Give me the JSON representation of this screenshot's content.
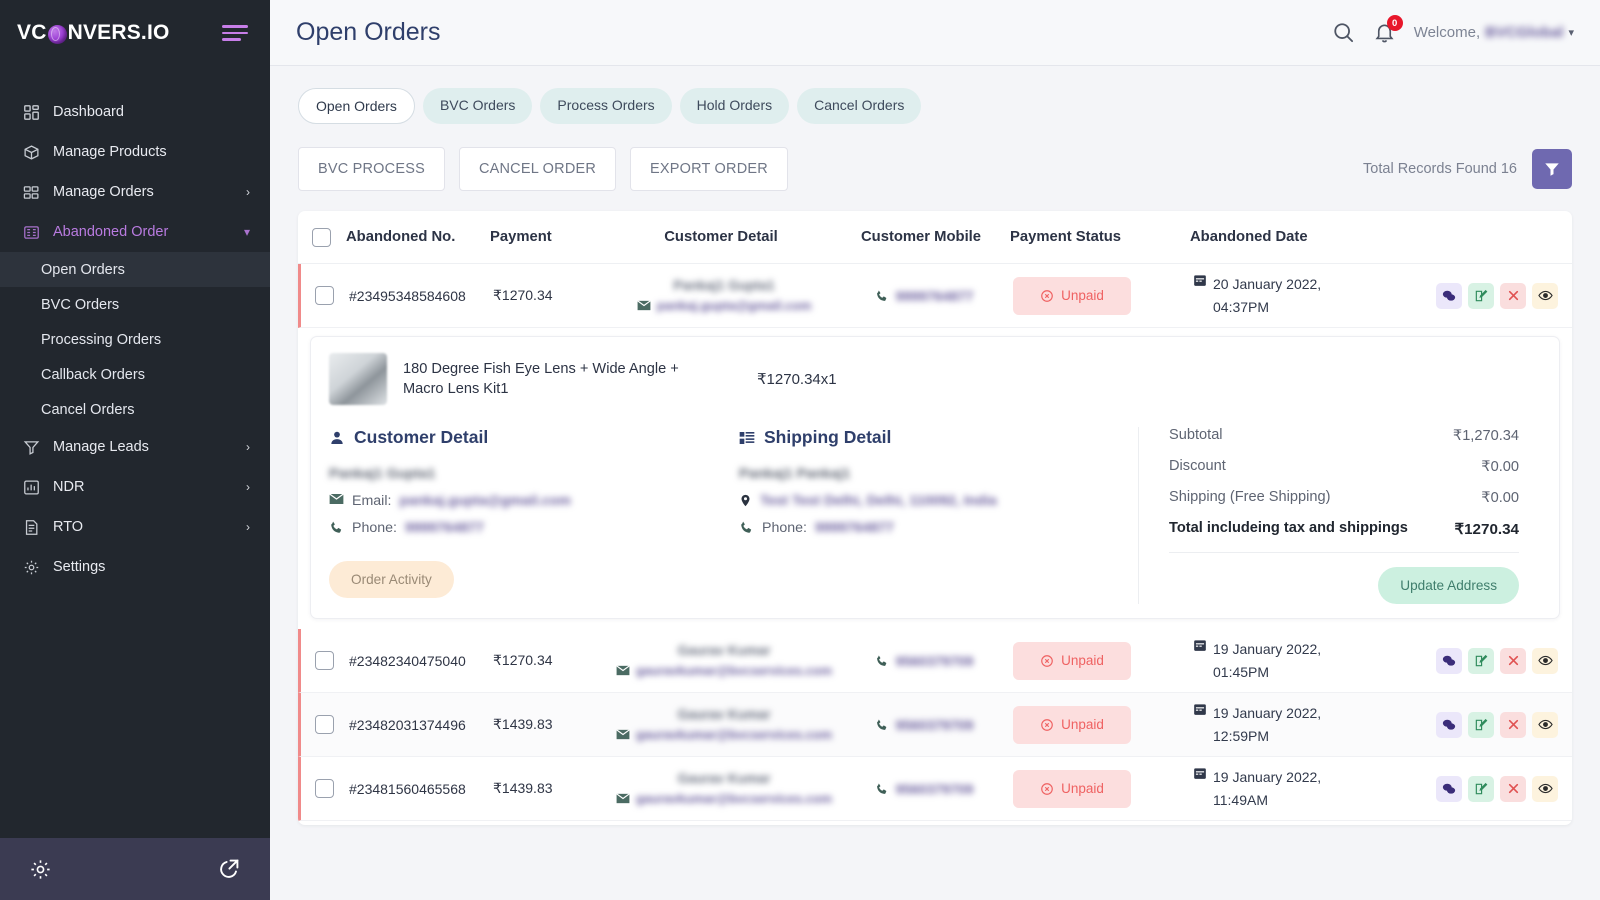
{
  "sidebar": {
    "logo_text_before": "VC",
    "logo_text_after": "NVERS.IO",
    "items": [
      {
        "label": "Dashboard",
        "icon": "dashboard-icon",
        "expandable": false
      },
      {
        "label": "Manage Products",
        "icon": "package-icon",
        "expandable": false
      },
      {
        "label": "Manage Orders",
        "icon": "orders-icon",
        "expandable": true,
        "chevron": "›"
      },
      {
        "label": "Abandoned Order",
        "icon": "abandoned-cart-icon",
        "expandable": true,
        "chevron": "⌄",
        "active": true
      }
    ],
    "sub_items": [
      {
        "label": "Open Orders",
        "selected": true
      },
      {
        "label": "BVC Orders",
        "selected": false
      },
      {
        "label": "Processing Orders",
        "selected": false
      },
      {
        "label": "Callback Orders",
        "selected": false
      },
      {
        "label": "Cancel Orders",
        "selected": false
      }
    ],
    "items_after": [
      {
        "label": "Manage Leads",
        "icon": "funnel-icon",
        "expandable": true,
        "chevron": "›"
      },
      {
        "label": "NDR",
        "icon": "chart-icon",
        "expandable": true,
        "chevron": "›"
      },
      {
        "label": "RTO",
        "icon": "document-icon",
        "expandable": true,
        "chevron": "›"
      },
      {
        "label": "Settings",
        "icon": "gear-icon",
        "expandable": false
      }
    ],
    "footer": {
      "left_icon": "gear-icon",
      "right_icon": "external-link-icon"
    }
  },
  "header": {
    "title": "Open Orders",
    "search_icon": "search-icon",
    "bell_icon": "bell-icon",
    "notification_count": "0",
    "welcome_prefix": "Welcome,",
    "username": "BVCGlobal",
    "caret": "▾"
  },
  "tabs": [
    {
      "label": "Open Orders",
      "active": true
    },
    {
      "label": "BVC Orders",
      "active": false
    },
    {
      "label": "Process Orders",
      "active": false
    },
    {
      "label": "Hold Orders",
      "active": false
    },
    {
      "label": "Cancel Orders",
      "active": false
    }
  ],
  "toolbar": {
    "bvc_process": "BVC PROCESS",
    "cancel_order": "CANCEL ORDER",
    "export_order": "EXPORT ORDER",
    "total_records": "Total Records Found 16",
    "filter_icon": "filter-icon",
    "filter_color": "#6f69b0"
  },
  "table": {
    "headers": [
      "Abandoned No.",
      "Payment",
      "Customer Detail",
      "Customer Mobile",
      "Payment Status",
      "Abandoned Date"
    ],
    "rows": [
      {
        "abandoned_no": "#23495348584608",
        "payment": "₹1270.34",
        "customer_name": "Pankaj1 Gupta1",
        "customer_email": "pankaj.gupta@gmail.com",
        "customer_mobile": "9999764877",
        "payment_status": "Unpaid",
        "date_line1": "20 January 2022,",
        "date_line2": "04:37PM",
        "expanded": true
      },
      {
        "abandoned_no": "#23482340475040",
        "payment": "₹1270.34",
        "customer_name": "Gaurav Kumar",
        "customer_email": "gauravkumar@bvcservices.com",
        "customer_mobile": "9560379709",
        "payment_status": "Unpaid",
        "date_line1": "19 January 2022,",
        "date_line2": "01:45PM",
        "expanded": false
      },
      {
        "abandoned_no": "#23482031374496",
        "payment": "₹1439.83",
        "customer_name": "Gaurav Kumar",
        "customer_email": "gauravkumar@bvcservices.com",
        "customer_mobile": "9560379709",
        "payment_status": "Unpaid",
        "date_line1": "19 January 2022,",
        "date_line2": "12:59PM",
        "expanded": false
      },
      {
        "abandoned_no": "#23481560465568",
        "payment": "₹1439.83",
        "customer_name": "Gaurav Kumar",
        "customer_email": "gauravkumar@bvcservices.com",
        "customer_mobile": "9560379709",
        "payment_status": "Unpaid",
        "date_line1": "19 January 2022,",
        "date_line2": "11:49AM",
        "expanded": false
      }
    ],
    "row_actions": [
      "chat-icon",
      "edit-icon",
      "close-icon",
      "eye-icon"
    ]
  },
  "detail_panel": {
    "product_name": "180 Degree Fish Eye Lens + Wide Angle + Macro Lens Kit1",
    "product_price": "₹1270.34x1",
    "customer_detail": {
      "title": "Customer Detail",
      "icon": "user-icon",
      "name": "Pankaj1 Gupta1",
      "email_label": "Email:",
      "email_value": "pankaj.gupta@gmail.com",
      "phone_label": "Phone:",
      "phone_value": "9999764877",
      "order_activity_button": "Order Activity"
    },
    "shipping_detail": {
      "title": "Shipping Detail",
      "icon": "shipping-icon",
      "name": "Pankaj1 Pankaj1",
      "address": "Test Test Delhi, Delhi, 110092, India",
      "phone_label": "Phone:",
      "phone_value": "9999764877"
    },
    "summary": {
      "rows": [
        {
          "label": "Subtotal",
          "value": "₹1,270.34"
        },
        {
          "label": "Discount",
          "value": "₹0.00"
        },
        {
          "label": "Shipping (Free Shipping)",
          "value": "₹0.00"
        }
      ],
      "total_label": "Total includeing tax and shippings",
      "total_value": "₹1270.34",
      "update_address_button": "Update Address"
    }
  }
}
